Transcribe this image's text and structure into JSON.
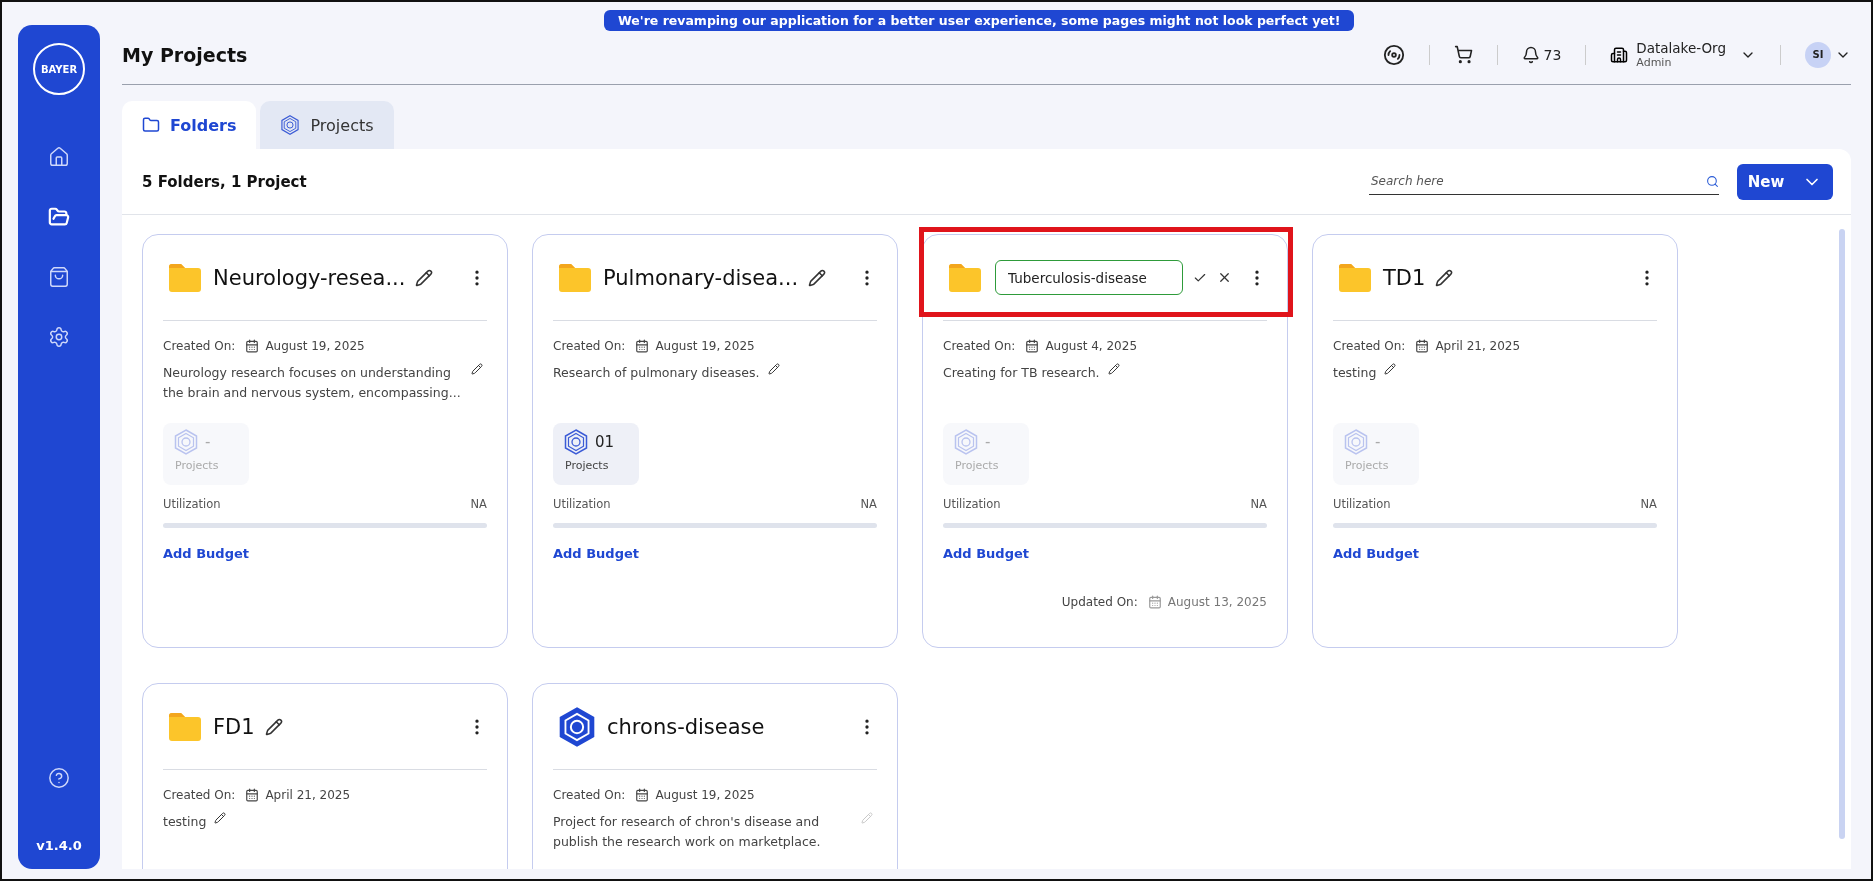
{
  "banner": "We're revamping our application for a better user experience, some pages might not look perfect yet!",
  "sidebar": {
    "logo_horizontal": "BAYER",
    "nav": [
      {
        "kind": "home",
        "selected": false
      },
      {
        "kind": "folders",
        "selected": true
      },
      {
        "kind": "shop",
        "selected": false
      },
      {
        "kind": "settings",
        "selected": false
      }
    ],
    "version": "v1.4.0"
  },
  "page_title": "My Projects",
  "header": {
    "notifications": "73",
    "org_name": "Datalake-Org",
    "org_role": "Admin",
    "avatar_initials": "SI"
  },
  "tabs": [
    {
      "kind": "folder",
      "label": "Folders",
      "selected": true
    },
    {
      "kind": "project",
      "label": "Projects",
      "selected": false
    }
  ],
  "summary": "5 Folders, 1 Project",
  "search": {
    "placeholder": "Search here"
  },
  "new_button": "New",
  "cards": [
    {
      "kind": "folder",
      "title": "Neurology-resea...",
      "editing": false,
      "highlighted": false,
      "created_label": "Created On:",
      "created_date": "August 19, 2025",
      "description": "Neurology research focuses on understanding the brain and nervous system, encompassing...",
      "description_editable": true,
      "projects_count": "-",
      "projects_label": "Projects",
      "projects_active": false,
      "utilization_label": "Utilization",
      "utilization_value": "NA",
      "budget_link": "Add Budget"
    },
    {
      "kind": "folder",
      "title": "Pulmonary-disea...",
      "editing": false,
      "highlighted": false,
      "created_label": "Created On:",
      "created_date": "August 19, 2025",
      "description": "Research of pulmonary diseases.",
      "description_editable": true,
      "projects_count": "01",
      "projects_label": "Projects",
      "projects_active": true,
      "utilization_label": "Utilization",
      "utilization_value": "NA",
      "budget_link": "Add Budget"
    },
    {
      "kind": "folder",
      "title": "Tuberculosis-disease",
      "editing": true,
      "highlighted": true,
      "created_label": "Created On:",
      "created_date": "August 4, 2025",
      "description": "Creating for TB research.",
      "description_editable": true,
      "projects_count": "-",
      "projects_label": "Projects",
      "projects_active": false,
      "utilization_label": "Utilization",
      "utilization_value": "NA",
      "budget_link": "Add Budget",
      "updated_label": "Updated On:",
      "updated_date": "August 13, 2025"
    },
    {
      "kind": "folder",
      "title": "TD1",
      "editing": false,
      "highlighted": false,
      "created_label": "Created On:",
      "created_date": "April 21, 2025",
      "description": "testing",
      "description_editable": true,
      "projects_count": "-",
      "projects_label": "Projects",
      "projects_active": false,
      "utilization_label": "Utilization",
      "utilization_value": "NA",
      "budget_link": "Add Budget"
    },
    {
      "kind": "folder",
      "title": "FD1",
      "editing": false,
      "highlighted": false,
      "created_label": "Created On:",
      "created_date": "April 21, 2025",
      "description": "testing",
      "description_editable": true
    },
    {
      "kind": "project",
      "title": "chrons-disease",
      "editing": false,
      "highlighted": false,
      "created_label": "Created On:",
      "created_date": "August 19, 2025",
      "description": "Project for research of chron's disease and publish the research work on marketplace.",
      "description_editable": false
    }
  ]
}
